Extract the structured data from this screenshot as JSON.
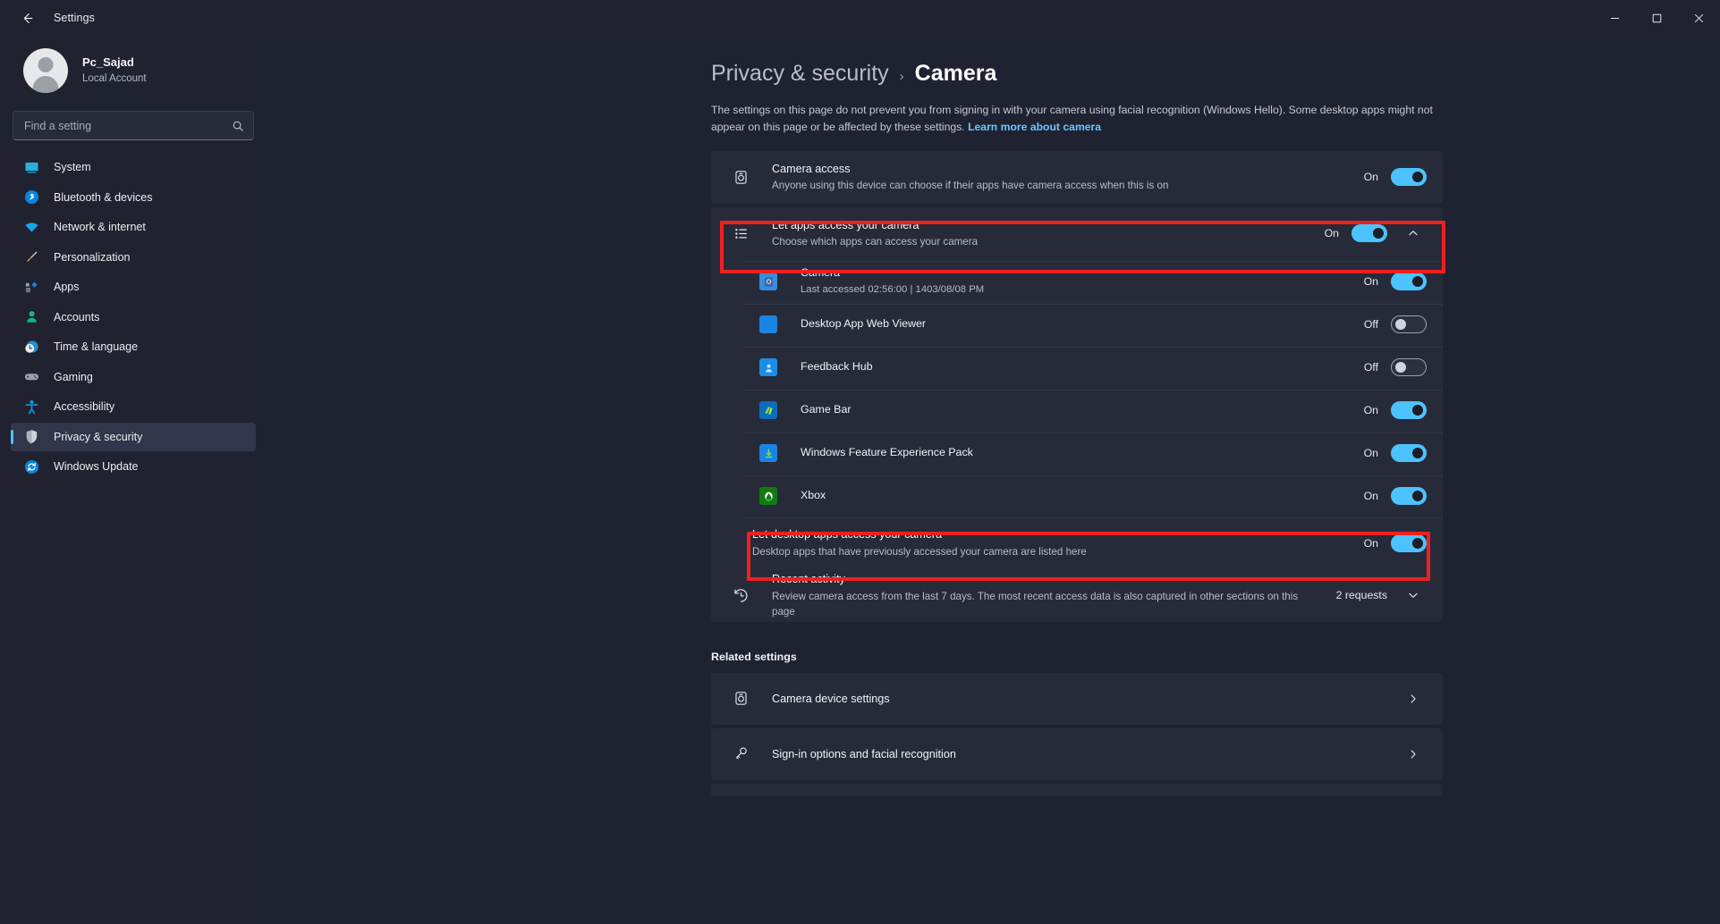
{
  "window": {
    "title": "Settings",
    "back_icon": "back-arrow-icon",
    "minimize": "─",
    "maximize": "☐",
    "close": "✕"
  },
  "account": {
    "name": "Pc_Sajad",
    "subtitle": "Local Account"
  },
  "search": {
    "placeholder": "Find a setting",
    "value": ""
  },
  "sidebar": {
    "items": [
      {
        "label": "System",
        "icon": "monitor-icon",
        "active": false
      },
      {
        "label": "Bluetooth & devices",
        "icon": "bluetooth-icon",
        "active": false
      },
      {
        "label": "Network & internet",
        "icon": "wifi-icon",
        "active": false
      },
      {
        "label": "Personalization",
        "icon": "paintbrush-icon",
        "active": false
      },
      {
        "label": "Apps",
        "icon": "apps-icon",
        "active": false
      },
      {
        "label": "Accounts",
        "icon": "person-icon",
        "active": false
      },
      {
        "label": "Time & language",
        "icon": "clock-globe-icon",
        "active": false
      },
      {
        "label": "Gaming",
        "icon": "gamepad-icon",
        "active": false
      },
      {
        "label": "Accessibility",
        "icon": "accessibility-icon",
        "active": false
      },
      {
        "label": "Privacy & security",
        "icon": "shield-icon",
        "active": true
      },
      {
        "label": "Windows Update",
        "icon": "update-icon",
        "active": false
      }
    ]
  },
  "page": {
    "breadcrumb_parent": "Privacy & security",
    "breadcrumb_sep": "›",
    "breadcrumb_current": "Camera",
    "description": "The settings on this page do not prevent you from signing in with your camera using facial recognition (Windows Hello). Some desktop apps might not appear on this page or be affected by these settings.",
    "description_link": "Learn more about camera"
  },
  "camera_access": {
    "title": "Camera access",
    "subtitle": "Anyone using this device can choose if their apps have camera access when this is on",
    "state": "On",
    "toggle_on": true,
    "icon": "camera-icon"
  },
  "let_apps": {
    "title": "Let apps access your camera",
    "subtitle": "Choose which apps can access your camera",
    "state": "On",
    "toggle_on": true,
    "icon": "list-icon",
    "expand_icon": "chevron-up-icon",
    "highlighted": true
  },
  "apps": [
    {
      "name": "Camera",
      "meta": "Last accessed 02:56:00  |  1403/08/08 PM",
      "state": "On",
      "toggle_on": true,
      "icon": "camera-app-icon",
      "icon_color": "#3a8ddb"
    },
    {
      "name": "Desktop App Web Viewer",
      "meta": "",
      "state": "Off",
      "toggle_on": false,
      "icon": "web-viewer-icon",
      "icon_color": "#1a84e2"
    },
    {
      "name": "Feedback Hub",
      "meta": "",
      "state": "Off",
      "toggle_on": false,
      "icon": "feedback-hub-icon",
      "icon_color": "#1c8ce8"
    },
    {
      "name": "Game Bar",
      "meta": "",
      "state": "On",
      "toggle_on": true,
      "icon": "game-bar-icon",
      "icon_color": "#2d8f3e"
    },
    {
      "name": "Windows Feature Experience Pack",
      "meta": "",
      "state": "On",
      "toggle_on": true,
      "icon": "feature-pack-icon",
      "icon_color": "#1a84e2"
    },
    {
      "name": "Xbox",
      "meta": "",
      "state": "On",
      "toggle_on": true,
      "icon": "xbox-icon",
      "icon_color": "#107c10"
    }
  ],
  "let_desktop_apps": {
    "title": "Let desktop apps access your camera",
    "subtitle": "Desktop apps that have previously accessed your camera are listed here",
    "state": "On",
    "toggle_on": true,
    "highlighted": true
  },
  "recent_activity": {
    "title": "Recent activity",
    "subtitle": "Review camera access from the last 7 days. The most recent access data is also captured in other sections on this page",
    "badge": "2 requests",
    "icon": "history-icon",
    "expand_icon": "chevron-down-icon"
  },
  "related": {
    "heading": "Related settings",
    "items": [
      {
        "label": "Camera device settings",
        "icon": "camera-icon",
        "chevron": "›"
      },
      {
        "label": "Sign-in options and facial recognition",
        "icon": "key-icon",
        "chevron": "›"
      }
    ]
  },
  "colors": {
    "accent": "#4cc2ff",
    "link": "#6fc5ff",
    "highlight_box": "#f02020",
    "card_bg": "#272b39",
    "page_bg": "#1f2230",
    "sidebar_bg": "#20232f"
  }
}
